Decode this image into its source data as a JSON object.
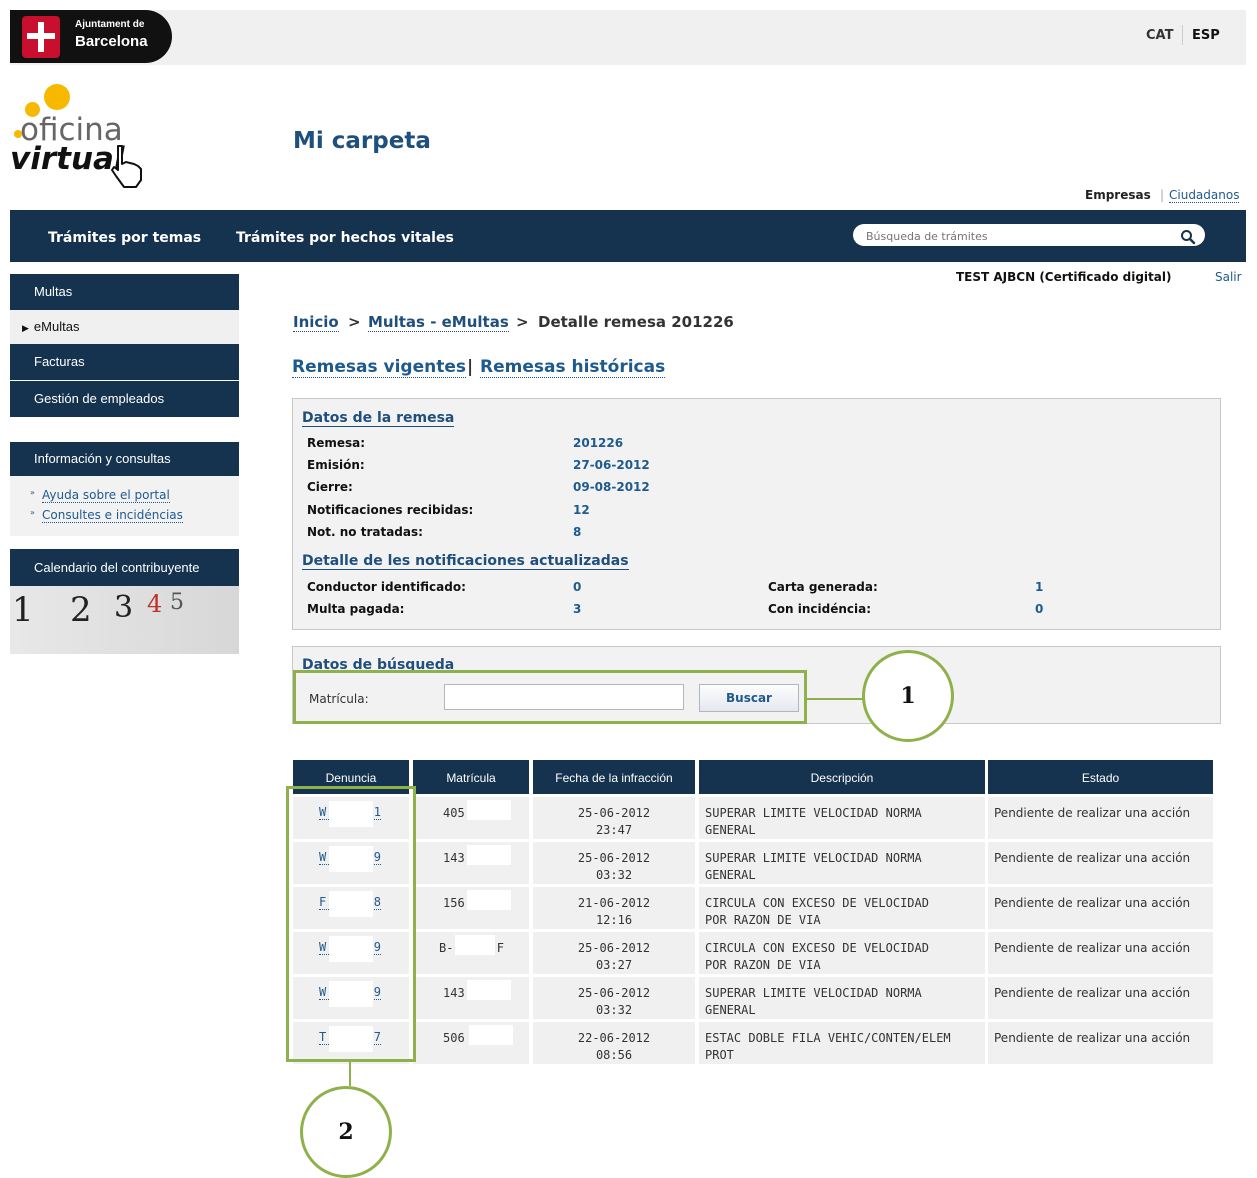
{
  "header": {
    "logo_line1": "Ajuntament de",
    "logo_line2": "Barcelona",
    "lang_cat": "CAT",
    "lang_esp": "ESP"
  },
  "brand": {
    "oficina": "oficina",
    "virtual": "virtual",
    "page_title": "Mi carpeta"
  },
  "audience": {
    "empresas": "Empresas",
    "separator": "|",
    "ciudadanos": "Ciudadanos"
  },
  "nav": {
    "item1": "Trámites por temas",
    "item2": "Trámites por hechos vitales",
    "search_placeholder": "Búsqueda de trámites"
  },
  "user": {
    "name": "TEST AJBCN (Certificado digital)",
    "logout": "Salir"
  },
  "sidebar": {
    "multas": "Multas",
    "emultas": "eMultas",
    "facturas": "Facturas",
    "gestion": "Gestión de empleados",
    "info_title": "Información y consultas",
    "info_link1": "Ayuda sobre el portal",
    "info_link2": "Consultes e incidéncias",
    "calendar_title": "Calendario del contribuyente",
    "calendar_numbers": [
      "1",
      "2",
      "3",
      "4",
      "5"
    ]
  },
  "breadcrumb": {
    "inicio": "Inicio",
    "sep": ">",
    "multas": "Multas - eMultas",
    "current": "Detalle remesa 201226"
  },
  "tabs": {
    "vigentes": "Remesas vigentes",
    "sep": "|",
    "historicas": "Remesas históricas"
  },
  "remesa": {
    "title": "Datos de la remesa",
    "remesa_label": "Remesa:",
    "remesa_value": "201226",
    "emision_label": "Emisión:",
    "emision_value": "27-06-2012",
    "cierre_label": "Cierre:",
    "cierre_value": "09-08-2012",
    "recibidas_label": "Notificaciones recibidas:",
    "recibidas_value": "12",
    "no_tratadas_label": "Not. no tratadas:",
    "no_tratadas_value": "8"
  },
  "detalle": {
    "title": "Detalle de les notificaciones actualizadas",
    "conductor_label": "Conductor identificado:",
    "conductor_value": "0",
    "pagada_label": "Multa pagada:",
    "pagada_value": "3",
    "carta_label": "Carta generada:",
    "carta_value": "1",
    "incidencia_label": "Con incidéncia:",
    "incidencia_value": "0"
  },
  "busqueda": {
    "title": "Datos de búsqueda",
    "matricula_label": "Matrícula:",
    "matricula_value": "",
    "buscar_label": "Buscar"
  },
  "callouts": {
    "one": "1",
    "two": "2"
  },
  "table": {
    "headers": [
      "Denuncia",
      "Matrícula",
      "Fecha de la infracción",
      "Descripción",
      "Estado"
    ],
    "rows": [
      {
        "den_a": "W",
        "den_b": "1",
        "mat": "405",
        "date": "25-06-2012",
        "time": "23:47",
        "desc1": "SUPERAR LIMITE VELOCIDAD NORMA",
        "desc2": "GENERAL",
        "estado": "Pendiente de realizar una acción"
      },
      {
        "den_a": "W",
        "den_b": "9",
        "mat": "143",
        "date": "25-06-2012",
        "time": "03:32",
        "desc1": "SUPERAR LIMITE VELOCIDAD NORMA",
        "desc2": "GENERAL",
        "estado": "Pendiente de realizar una acción"
      },
      {
        "den_a": "F",
        "den_b": "8",
        "mat": "156",
        "date": "21-06-2012",
        "time": "12:16",
        "desc1": "CIRCULA CON EXCESO DE VELOCIDAD",
        "desc2": "POR RAZON DE VIA",
        "estado": "Pendiente de realizar una acción"
      },
      {
        "den_a": "W",
        "den_b": "9",
        "mat": "B-      F",
        "date": "25-06-2012",
        "time": "03:27",
        "desc1": "CIRCULA CON EXCESO DE VELOCIDAD",
        "desc2": "POR RAZON DE VIA",
        "estado": "Pendiente de realizar una acción"
      },
      {
        "den_a": "W",
        "den_b": "9",
        "mat": "143",
        "date": "25-06-2012",
        "time": "03:32",
        "desc1": "SUPERAR LIMITE VELOCIDAD NORMA",
        "desc2": "GENERAL",
        "estado": "Pendiente de realizar una acción"
      },
      {
        "den_a": "T",
        "den_b": "7",
        "mat": "506",
        "date": "22-06-2012",
        "time": "08:56",
        "desc1": "ESTAC DOBLE FILA VEHIC/CONTEN/ELEM",
        "desc2": "PROT",
        "estado": "Pendiente de realizar una acción"
      }
    ]
  },
  "colors": {
    "navy": "#15334f",
    "link_blue": "#1f5a8e",
    "highlight_green": "#8fb14b",
    "brand_red": "#c8102e",
    "brand_yellow": "#f7b900"
  }
}
